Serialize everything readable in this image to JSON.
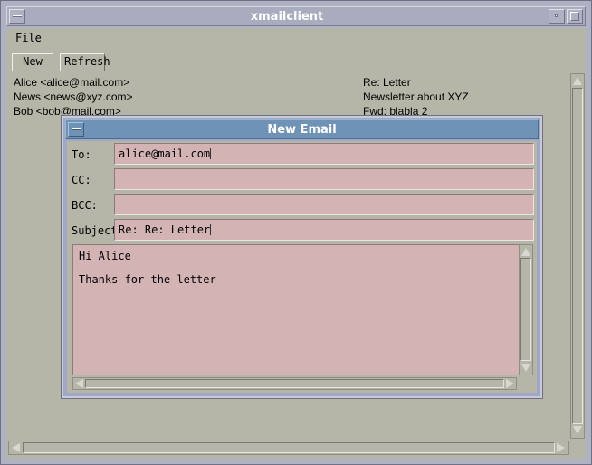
{
  "window": {
    "title": "xmailclient"
  },
  "menubar": {
    "file_prefix": "F",
    "file_rest": "ile"
  },
  "toolbar": {
    "new_label": "New",
    "refresh_label": "Refresh"
  },
  "messages": [
    {
      "from": "Alice <alice@mail.com>",
      "subject": "Re: Letter"
    },
    {
      "from": "News <news@xyz.com>",
      "subject": "Newsletter about XYZ"
    },
    {
      "from": "Bob <bob@mail.com>",
      "subject": "Fwd: blabla 2"
    }
  ],
  "dialog": {
    "title": "New Email",
    "to_label": "To:",
    "to_value": "alice@mail.com",
    "cc_label": "CC:",
    "cc_value": "",
    "bcc_label": "BCC:",
    "bcc_value": "",
    "subject_label": "Subject",
    "subject_value": "Re: Re: Letter",
    "body_lines": [
      "Hi Alice",
      "",
      "Thanks for the letter"
    ]
  },
  "colors": {
    "window_bg": "#b5b5a8",
    "input_bg": "#d4b3b5",
    "dialog_title_bg": "#6f93b6",
    "main_title_bg": "#a9acbe"
  },
  "icons": [
    "window-menu-icon",
    "minimize-icon",
    "maximize-icon",
    "scroll-up-arrow-icon",
    "scroll-down-arrow-icon",
    "scroll-left-arrow-icon",
    "scroll-right-arrow-icon"
  ]
}
